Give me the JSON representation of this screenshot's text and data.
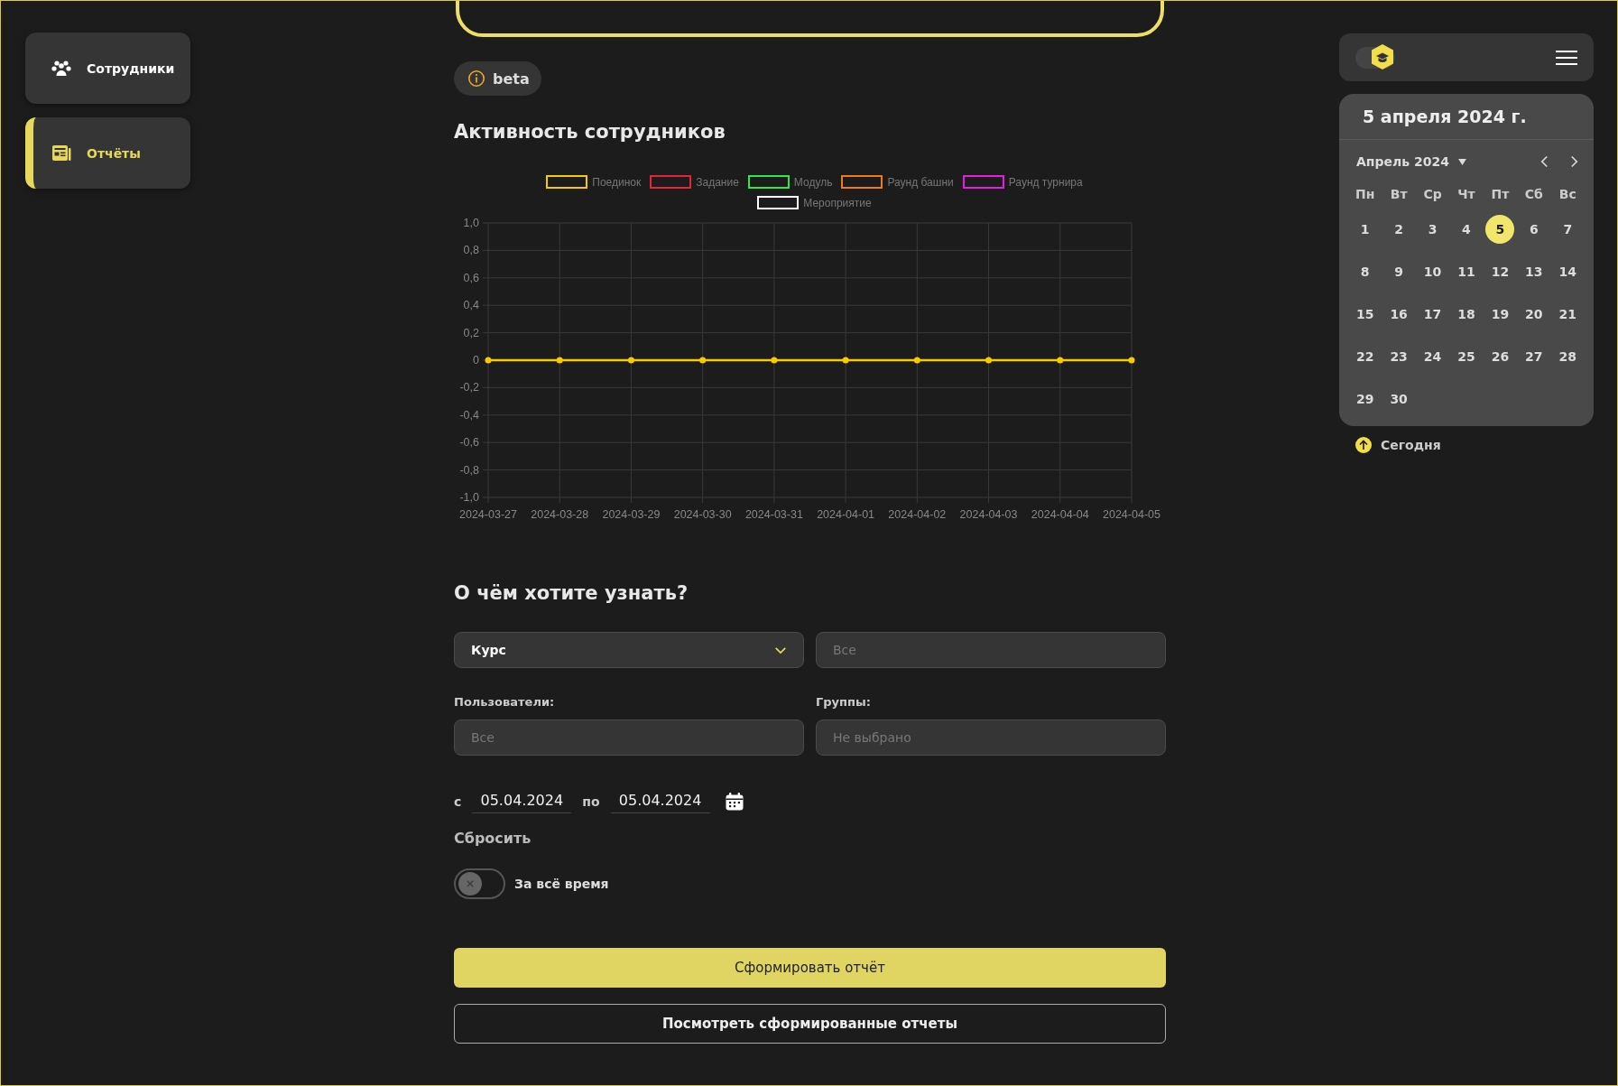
{
  "sidebar": {
    "items": [
      {
        "label": "Сотрудники",
        "selected": false
      },
      {
        "label": "Отчёты",
        "selected": true
      }
    ]
  },
  "badge": {
    "label": "beta"
  },
  "activity": {
    "title": "Активность сотрудников",
    "chart_data": {
      "type": "line",
      "categories": [
        "2024-03-27",
        "2024-03-28",
        "2024-03-29",
        "2024-03-30",
        "2024-03-31",
        "2024-04-01",
        "2024-04-02",
        "2024-04-03",
        "2024-04-04",
        "2024-04-05"
      ],
      "ylim": [
        -1,
        1
      ],
      "grid": true,
      "legend": "top",
      "yticks": [
        {
          "value": 1,
          "label": "1,0"
        },
        {
          "value": 0.8,
          "label": "0,8"
        },
        {
          "value": 0.6,
          "label": "0,6"
        },
        {
          "value": 0.4,
          "label": "0,4"
        },
        {
          "value": 0.2,
          "label": "0,2"
        },
        {
          "value": 0,
          "label": "0"
        },
        {
          "value": -0.2,
          "label": "-0,2"
        },
        {
          "value": -0.4,
          "label": "-0,4"
        },
        {
          "value": -0.6,
          "label": "-0,6"
        },
        {
          "value": -0.8,
          "label": "-0,8"
        },
        {
          "value": -1,
          "label": "-1,0"
        }
      ],
      "series": [
        {
          "name": "Поединок",
          "color": "#f5cc00",
          "marker": "circle",
          "values": [
            0,
            0,
            0,
            0,
            0,
            0,
            0,
            0,
            0,
            0
          ]
        },
        {
          "name": "Задание",
          "color": "#e8243c",
          "values": [
            null,
            null,
            null,
            null,
            null,
            null,
            null,
            null,
            null,
            null
          ]
        },
        {
          "name": "Модуль",
          "color": "#2ee84a",
          "values": [
            null,
            null,
            null,
            null,
            null,
            null,
            null,
            null,
            null,
            null
          ]
        },
        {
          "name": "Раунд башни",
          "color": "#f07a1a",
          "values": [
            null,
            null,
            null,
            null,
            null,
            null,
            null,
            null,
            null,
            null
          ]
        },
        {
          "name": "Раунд турнира",
          "color": "#e81ae8",
          "values": [
            null,
            null,
            null,
            null,
            null,
            null,
            null,
            null,
            null,
            null
          ]
        },
        {
          "name": "Мероприятие",
          "color": "#ffffff",
          "values": [
            null,
            null,
            null,
            null,
            null,
            null,
            null,
            null,
            null,
            null
          ]
        }
      ]
    }
  },
  "query": {
    "title": "О чём хотите узнать?",
    "select": {
      "value": "Курс"
    },
    "target": {
      "placeholder": "Все"
    },
    "users": {
      "label": "Пользователи:",
      "placeholder": "Все"
    },
    "groups": {
      "label": "Группы:",
      "placeholder": "Не выбрано"
    },
    "date_from_label": "с",
    "date_from": "05.04.2024",
    "date_to_label": "по",
    "date_to": "05.04.2024",
    "reset": "Сбросить",
    "all_time": {
      "label": "За всё время",
      "on": false
    },
    "buttons": [
      {
        "label": "Сформировать отчёт",
        "kind": "primary"
      },
      {
        "label": "Посмотреть сформированные отчеты",
        "kind": "outline"
      }
    ]
  },
  "calendar": {
    "title": "5 апреля 2024 г.",
    "month": "Апрель 2024",
    "weekdays": [
      "Пн",
      "Вт",
      "Ср",
      "Чт",
      "Пт",
      "Сб",
      "Вс"
    ],
    "days": [
      {
        "label": "1",
        "selected": false
      },
      {
        "label": "2",
        "selected": false
      },
      {
        "label": "3",
        "selected": false
      },
      {
        "label": "4",
        "selected": false
      },
      {
        "label": "5",
        "selected": true
      },
      {
        "label": "6",
        "selected": false
      },
      {
        "label": "7",
        "selected": false
      },
      {
        "label": "8",
        "selected": false
      },
      {
        "label": "9",
        "selected": false
      },
      {
        "label": "10",
        "selected": false
      },
      {
        "label": "11",
        "selected": false
      },
      {
        "label": "12",
        "selected": false
      },
      {
        "label": "13",
        "selected": false
      },
      {
        "label": "14",
        "selected": false
      },
      {
        "label": "15",
        "selected": false
      },
      {
        "label": "16",
        "selected": false
      },
      {
        "label": "17",
        "selected": false
      },
      {
        "label": "18",
        "selected": false
      },
      {
        "label": "19",
        "selected": false
      },
      {
        "label": "20",
        "selected": false
      },
      {
        "label": "21",
        "selected": false
      },
      {
        "label": "22",
        "selected": false
      },
      {
        "label": "23",
        "selected": false
      },
      {
        "label": "24",
        "selected": false
      },
      {
        "label": "25",
        "selected": false
      },
      {
        "label": "26",
        "selected": false
      },
      {
        "label": "27",
        "selected": false
      },
      {
        "label": "28",
        "selected": false
      },
      {
        "label": "29",
        "selected": false
      },
      {
        "label": "30",
        "selected": false
      }
    ],
    "today": "Сегодня"
  }
}
